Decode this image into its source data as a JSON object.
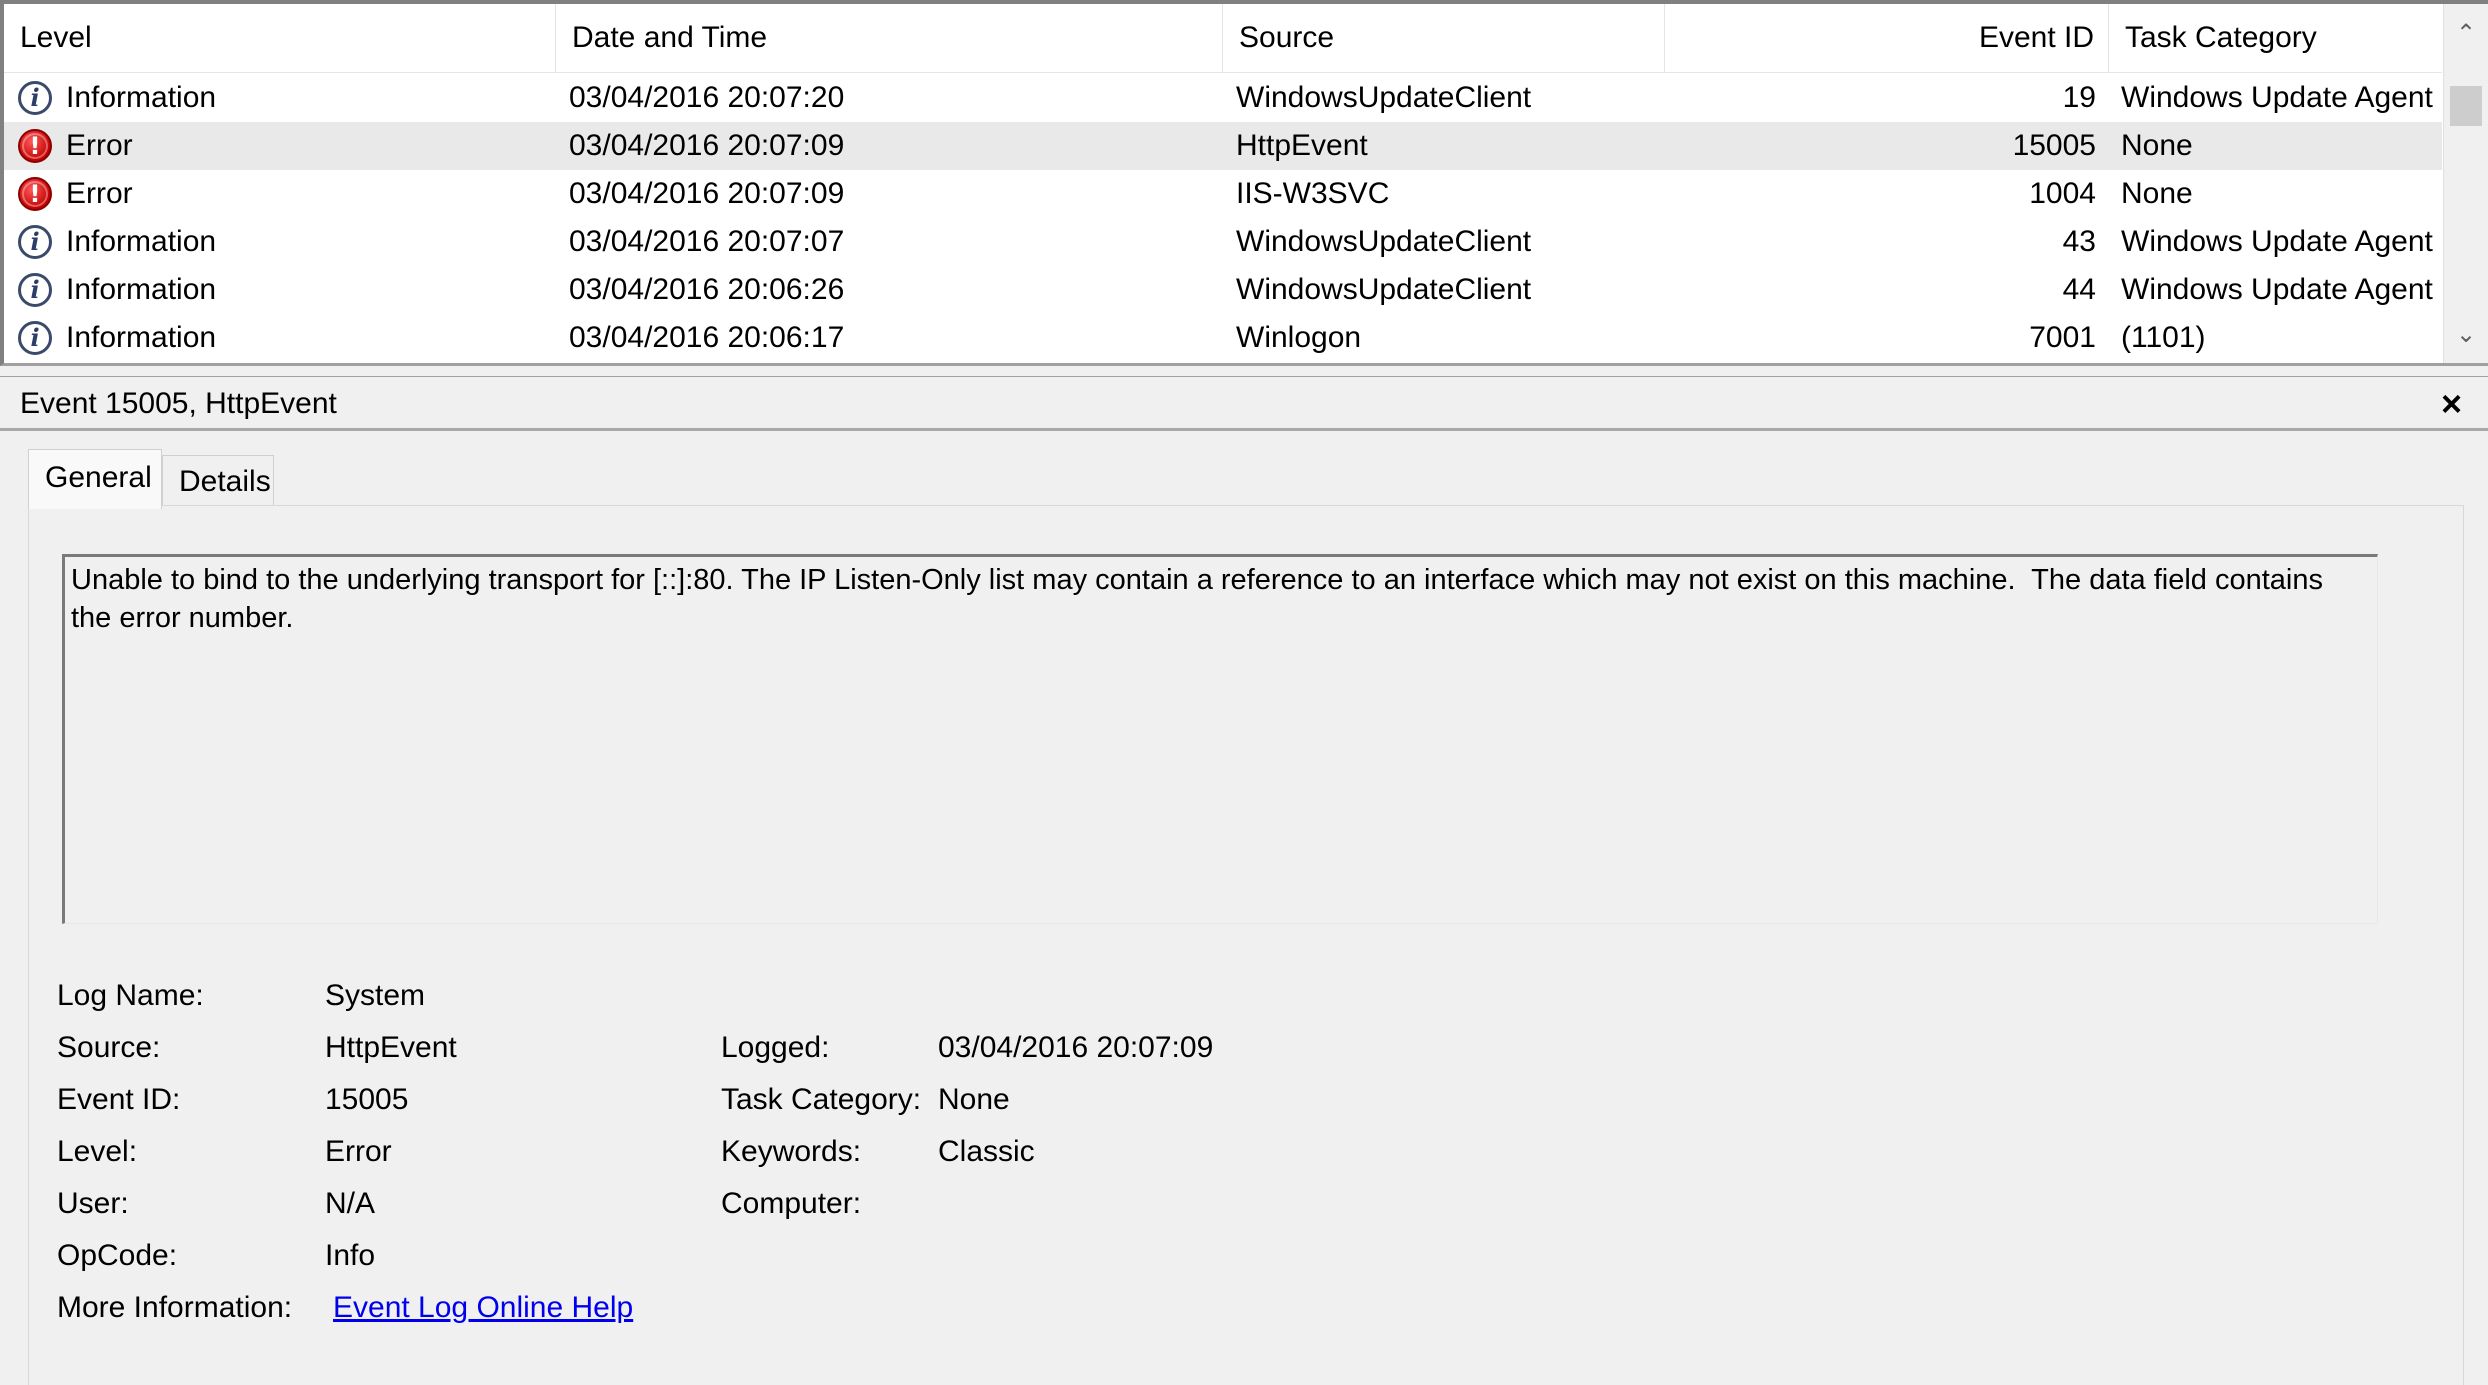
{
  "columns": {
    "level": "Level",
    "date_time": "Date and Time",
    "source": "Source",
    "event_id": "Event ID",
    "task_category": "Task Category"
  },
  "rows": [
    {
      "level": "Information",
      "icon": "information-icon",
      "date": "03/04/2016 20:07:20",
      "source": "WindowsUpdateClient",
      "event_id": "19",
      "task_category": "Windows Update Agent",
      "selected": false
    },
    {
      "level": "Error",
      "icon": "error-icon",
      "date": "03/04/2016 20:07:09",
      "source": "HttpEvent",
      "event_id": "15005",
      "task_category": "None",
      "selected": true
    },
    {
      "level": "Error",
      "icon": "error-icon",
      "date": "03/04/2016 20:07:09",
      "source": "IIS-W3SVC",
      "event_id": "1004",
      "task_category": "None",
      "selected": false
    },
    {
      "level": "Information",
      "icon": "information-icon",
      "date": "03/04/2016 20:07:07",
      "source": "WindowsUpdateClient",
      "event_id": "43",
      "task_category": "Windows Update Agent",
      "selected": false
    },
    {
      "level": "Information",
      "icon": "information-icon",
      "date": "03/04/2016 20:06:26",
      "source": "WindowsUpdateClient",
      "event_id": "44",
      "task_category": "Windows Update Agent",
      "selected": false
    },
    {
      "level": "Information",
      "icon": "information-icon",
      "date": "03/04/2016 20:06:17",
      "source": "Winlogon",
      "event_id": "7001",
      "task_category": "(1101)",
      "selected": false
    }
  ],
  "detail": {
    "title": "Event 15005, HttpEvent",
    "close_glyph": "×",
    "tabs": [
      "General",
      "Details"
    ],
    "description": "Unable to bind to the underlying transport for [::]:80. The IP Listen-Only list may contain a reference to an interface which may not exist on this machine.  The data field contains the error number.",
    "props": {
      "log_name_label": "Log Name:",
      "log_name": "System",
      "source_label": "Source:",
      "source": "HttpEvent",
      "logged_label": "Logged:",
      "logged": "03/04/2016 20:07:09",
      "event_id_label": "Event ID:",
      "event_id": "15005",
      "task_category_label": "Task Category:",
      "task_category": "None",
      "level_label": "Level:",
      "level": "Error",
      "keywords_label": "Keywords:",
      "keywords": "Classic",
      "user_label": "User:",
      "user": "N/A",
      "computer_label": "Computer:",
      "computer": "",
      "opcode_label": "OpCode:",
      "opcode": "Info",
      "more_info_label": "More Information:",
      "more_info_link": "Event Log Online Help"
    }
  },
  "colors": {
    "selected_row": "#e9e9e9",
    "link": "#0000ee",
    "error_red": "#c40000",
    "info_blue": "#2c3e66"
  }
}
